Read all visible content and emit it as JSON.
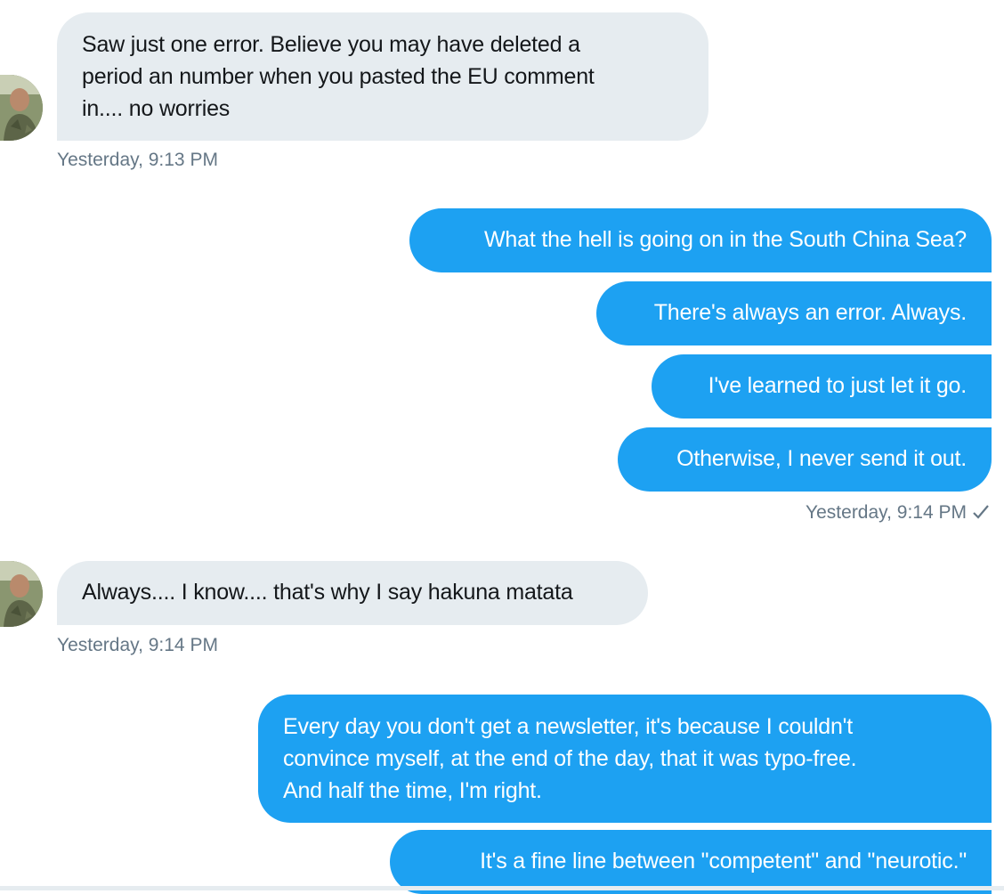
{
  "conversation": {
    "messages": [
      {
        "direction": "incoming",
        "text": "Saw just one error.  Believe you may have deleted a\nperiod an number when you pasted the EU comment\nin.... no worries"
      },
      {
        "direction": "outgoing",
        "text": "What the hell is going on in the South China Sea?"
      },
      {
        "direction": "outgoing",
        "text": "There's always an error. Always."
      },
      {
        "direction": "outgoing",
        "text": "I've learned to just let it go."
      },
      {
        "direction": "outgoing",
        "text": "Otherwise, I never send it out."
      },
      {
        "direction": "incoming",
        "text": "Always.... I know.... that's why I say hakuna matata"
      },
      {
        "direction": "outgoing",
        "text": "Every day you don't get a newsletter, it's because I couldn't\nconvince myself, at the end of the day, that it was typo-free.\nAnd half the time, I'm right."
      },
      {
        "direction": "outgoing",
        "text": "It's a fine line between \"competent\" and \"neurotic.\""
      }
    ],
    "timestamps": {
      "first_incoming": "Yesterday, 9:13 PM",
      "first_outgoing_group": "Yesterday, 9:14 PM",
      "second_incoming": "Yesterday, 9:14 PM"
    },
    "read_receipt_icon": "check-icon",
    "avatar_icon": "user-avatar-photo"
  },
  "colors": {
    "incoming_bubble": "#e6ecf0",
    "incoming_text": "#14171a",
    "outgoing_bubble": "#1da1f2",
    "outgoing_text": "#ffffff",
    "timestamp_text": "#657786"
  }
}
